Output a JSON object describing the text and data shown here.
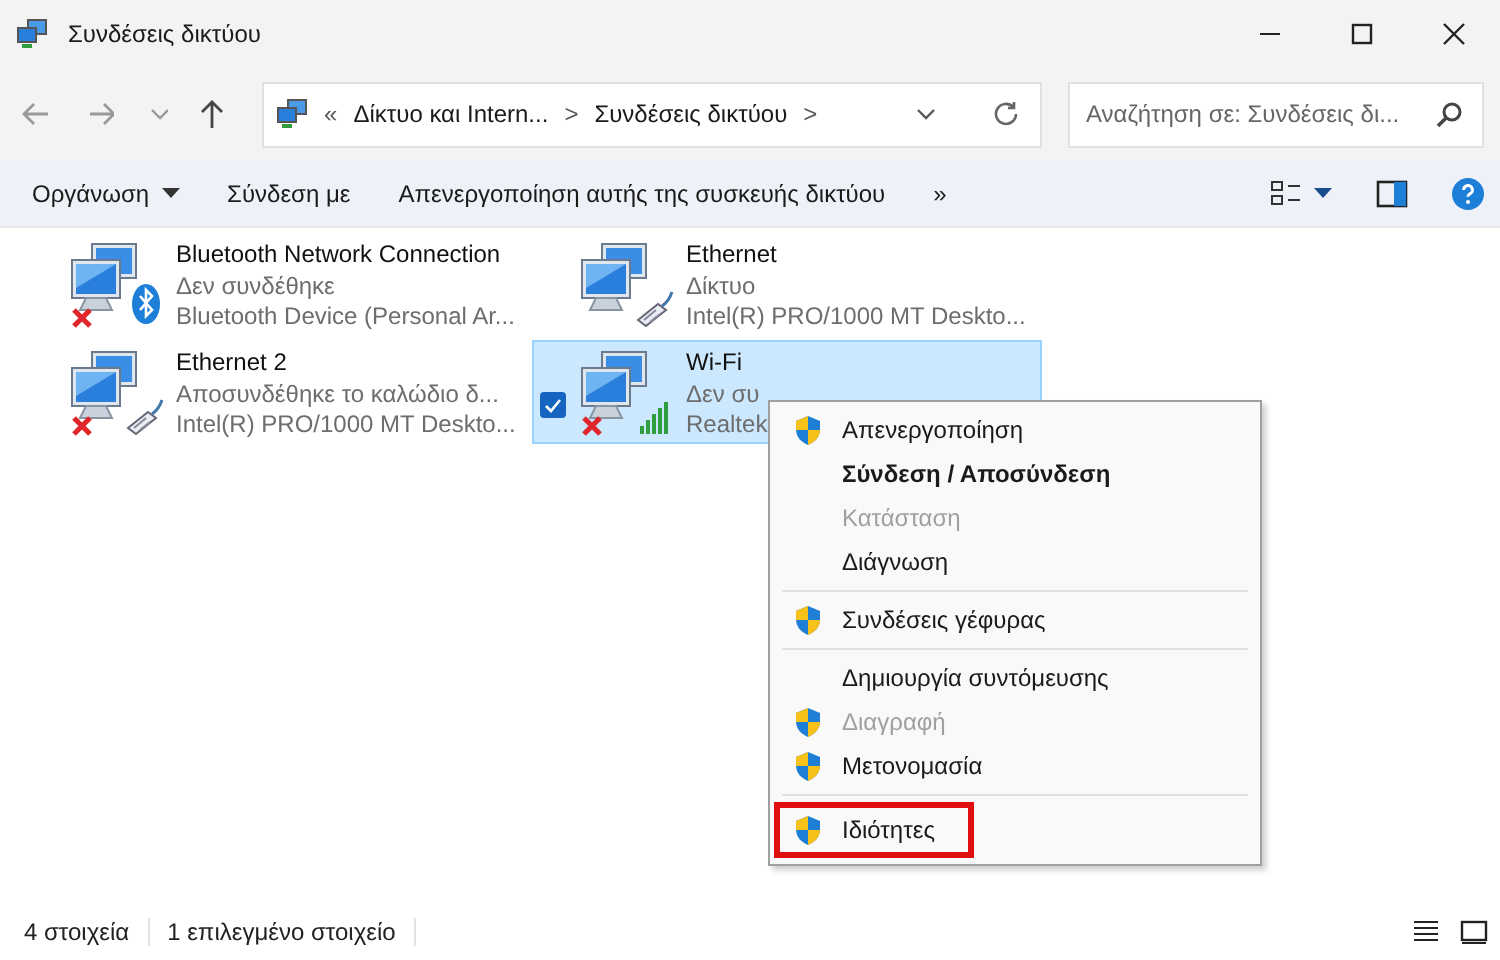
{
  "window": {
    "title": "Συνδέσεις δικτύου"
  },
  "address": {
    "crumbs": [
      {
        "kind": "overflow",
        "label": "«"
      },
      {
        "kind": "crumb",
        "label": "Δίκτυο και Intern..."
      },
      {
        "kind": "sep",
        "label": ">"
      },
      {
        "kind": "crumb",
        "label": "Συνδέσεις δικτύου"
      },
      {
        "kind": "sep",
        "label": ">"
      }
    ]
  },
  "search": {
    "placeholder": "Αναζήτηση σε: Συνδέσεις δι..."
  },
  "toolbar": {
    "items": [
      {
        "label": "Οργάνωση",
        "dropdown": true
      },
      {
        "label": "Σύνδεση με",
        "dropdown": false
      },
      {
        "label": "Απενεργοποίηση αυτής της συσκευής δικτύου",
        "dropdown": false
      },
      {
        "label": "»",
        "dropdown": false
      }
    ]
  },
  "connections": [
    {
      "name": "Bluetooth Network Connection",
      "status": "Δεν συνδέθηκε",
      "device": "Bluetooth Device (Personal Ar...",
      "kind": "bluetooth",
      "disconnected": true,
      "selected": false
    },
    {
      "name": "Ethernet",
      "status": "Δίκτυο",
      "device": "Intel(R) PRO/1000 MT Deskto...",
      "kind": "ethernet",
      "disconnected": false,
      "selected": false
    },
    {
      "name": "Ethernet 2",
      "status": "Αποσυνδέθηκε το καλώδιο δ...",
      "device": "Intel(R) PRO/1000 MT Deskto...",
      "kind": "ethernet",
      "disconnected": true,
      "selected": false
    },
    {
      "name": "Wi-Fi",
      "status": "Δεν συ",
      "device": "Realtek",
      "kind": "wifi",
      "disconnected": true,
      "selected": true
    }
  ],
  "context_menu": {
    "groups": [
      [
        {
          "label": "Απενεργοποίηση",
          "shield": true,
          "default": false,
          "disabled": false,
          "highlighted": false
        },
        {
          "label": "Σύνδεση / Αποσύνδεση",
          "shield": false,
          "default": true,
          "disabled": false,
          "highlighted": false
        },
        {
          "label": "Κατάσταση",
          "shield": false,
          "default": false,
          "disabled": true,
          "highlighted": false
        },
        {
          "label": "Διάγνωση",
          "shield": false,
          "default": false,
          "disabled": false,
          "highlighted": false
        }
      ],
      [
        {
          "label": "Συνδέσεις γέφυρας",
          "shield": true,
          "default": false,
          "disabled": false,
          "highlighted": false
        }
      ],
      [
        {
          "label": "Δημιουργία συντόμευσης",
          "shield": false,
          "default": false,
          "disabled": false,
          "highlighted": false
        },
        {
          "label": "Διαγραφή",
          "shield": true,
          "default": false,
          "disabled": true,
          "highlighted": false
        },
        {
          "label": "Μετονομασία",
          "shield": true,
          "default": false,
          "disabled": false,
          "highlighted": false
        }
      ],
      [
        {
          "label": "Ιδιότητες",
          "shield": true,
          "default": false,
          "disabled": false,
          "highlighted": true
        }
      ]
    ]
  },
  "status_bar": {
    "items": [
      "4 στοιχεία",
      "1 επιλεγμένο στοιχείο"
    ]
  }
}
